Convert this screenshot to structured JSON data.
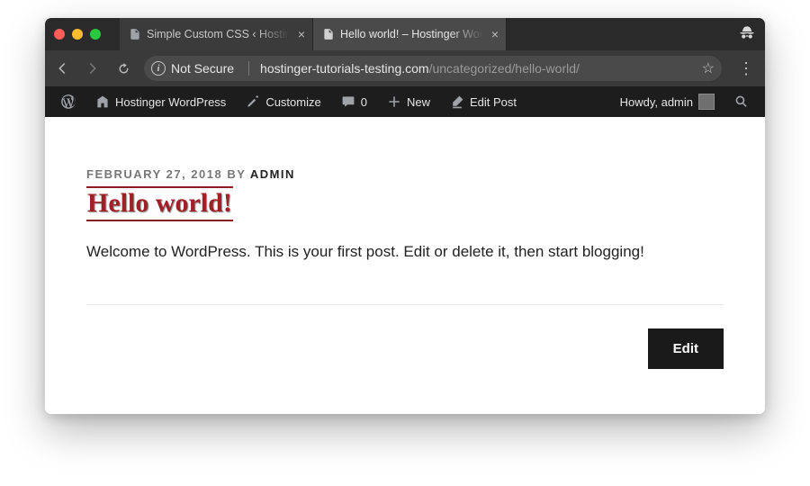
{
  "browser": {
    "tabs": [
      {
        "title": "Simple Custom CSS ‹ Hostinge",
        "active": false
      },
      {
        "title": "Hello world! – Hostinger WordP",
        "active": true
      }
    ],
    "omnibox": {
      "security_label": "Not Secure",
      "domain": "hostinger-tutorials-testing.com",
      "path": "/uncategorized/hello-world/"
    }
  },
  "wpbar": {
    "site_name": "Hostinger WordPress",
    "customize": "Customize",
    "comments_count": "0",
    "new_label": "New",
    "edit_post": "Edit Post",
    "greeting": "Howdy, admin"
  },
  "post": {
    "meta_date": "FEBRUARY 27, 2018",
    "meta_by": " BY ",
    "meta_author": "ADMIN",
    "title": "Hello world!",
    "body": "Welcome to WordPress. This is your first post. Edit or delete it, then start blogging!",
    "edit_button": "Edit"
  }
}
